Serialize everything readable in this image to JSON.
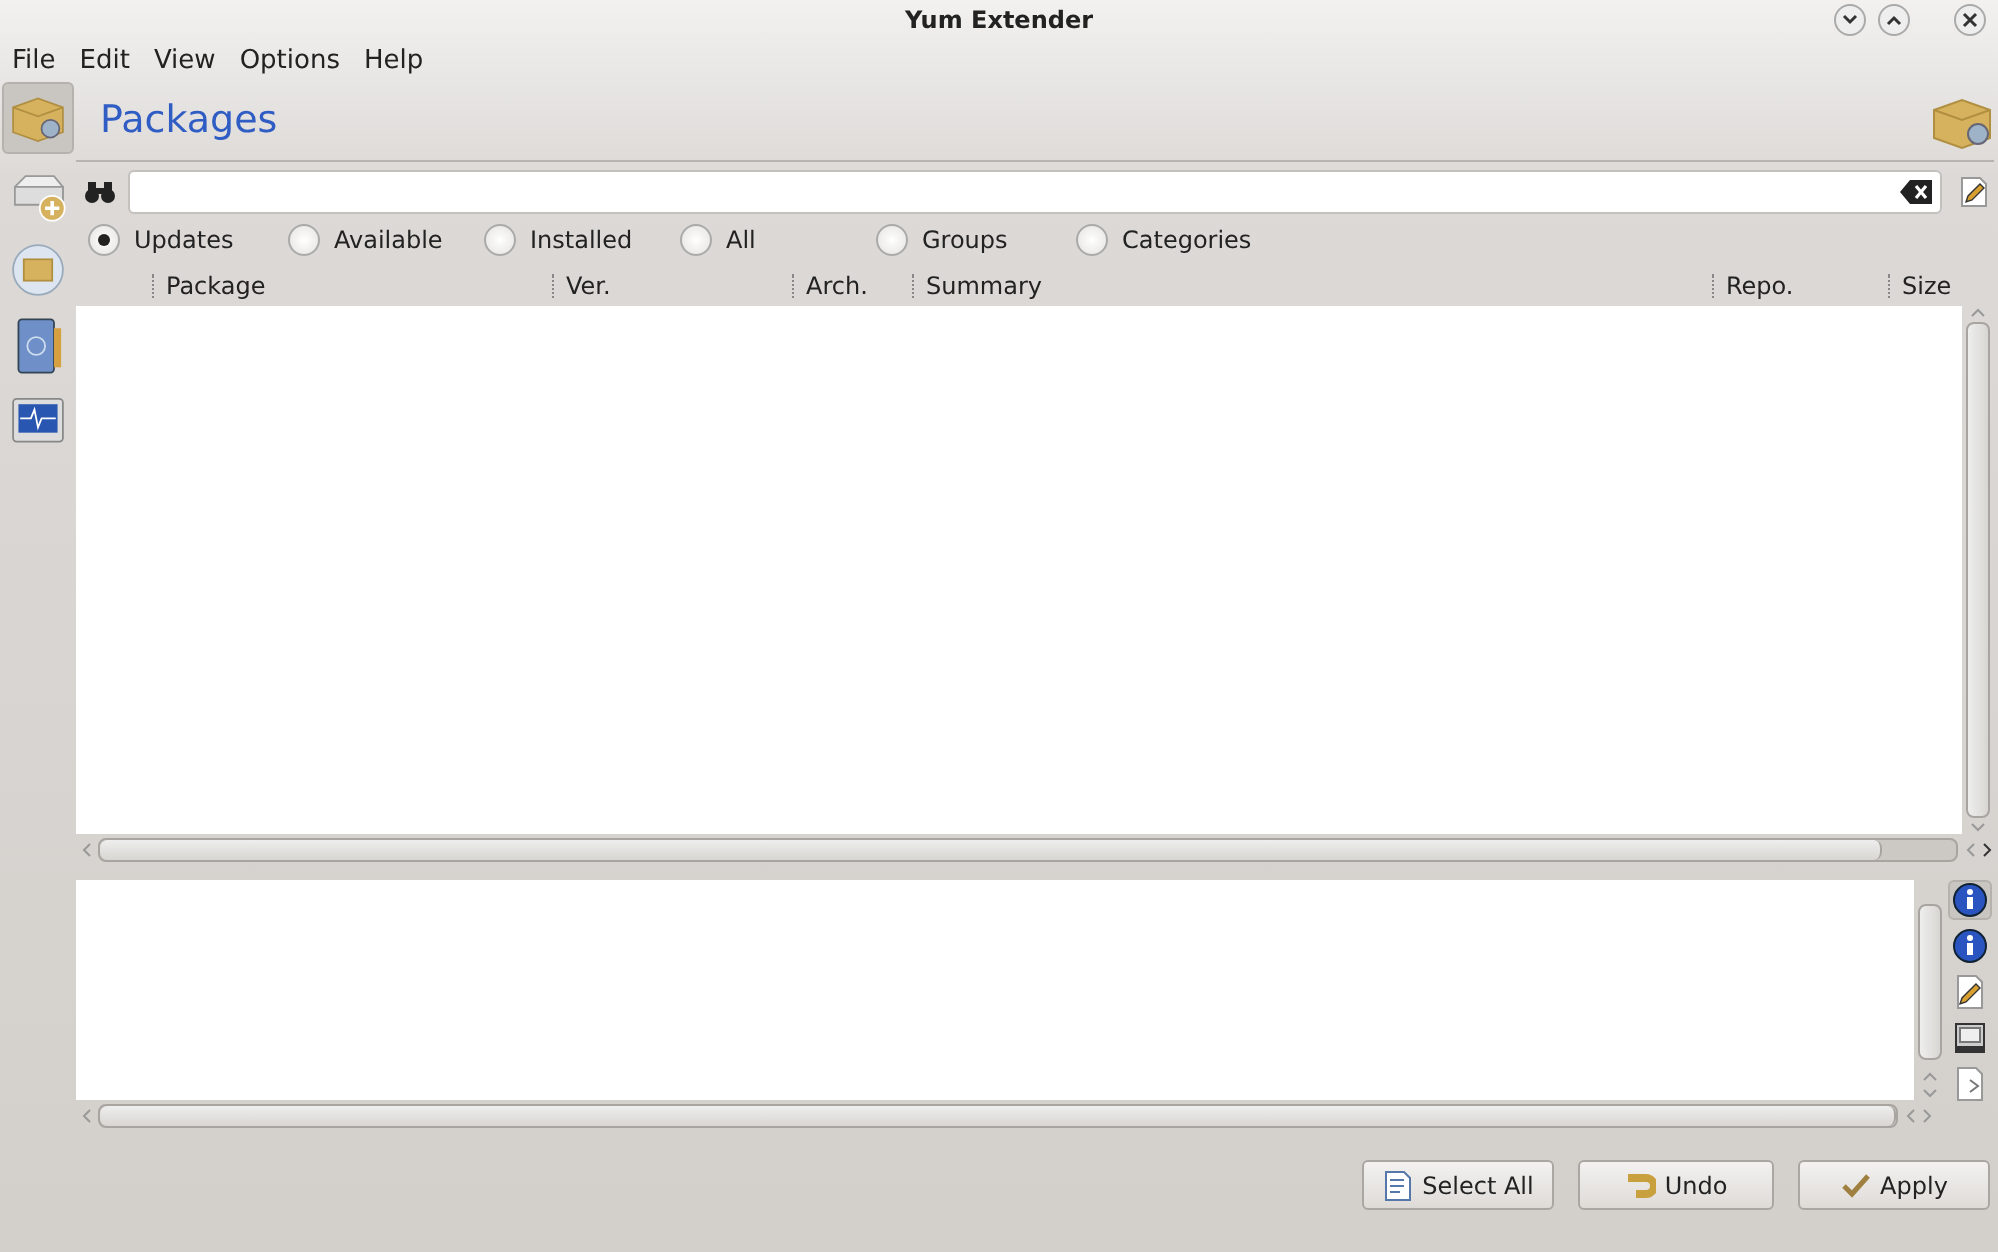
{
  "window": {
    "title": "Yum Extender"
  },
  "menu": [
    {
      "label": "File"
    },
    {
      "label": "Edit"
    },
    {
      "label": "View"
    },
    {
      "label": "Options"
    },
    {
      "label": "Help"
    }
  ],
  "sidebar": {
    "items": [
      {
        "kind": "packages",
        "selected": true
      },
      {
        "kind": "repos",
        "selected": false
      },
      {
        "kind": "queue",
        "selected": false
      },
      {
        "kind": "history",
        "selected": false
      },
      {
        "kind": "output",
        "selected": false
      }
    ]
  },
  "page_title": "Packages",
  "filters": [
    {
      "label": "Updates",
      "selected": true
    },
    {
      "label": "Available",
      "selected": false
    },
    {
      "label": "Installed",
      "selected": false
    },
    {
      "label": "All",
      "selected": false
    },
    {
      "label": "Groups",
      "selected": false
    },
    {
      "label": "Categories",
      "selected": false
    }
  ],
  "table": {
    "columns": [
      "Package",
      "Ver.",
      "Arch.",
      "Summary",
      "Repo.",
      "Size"
    ]
  },
  "info_tabs": [
    {
      "kind": "info",
      "selected": true
    },
    {
      "kind": "info",
      "selected": false
    },
    {
      "kind": "changelog",
      "selected": false
    },
    {
      "kind": "files",
      "selected": false
    },
    {
      "kind": "deps",
      "selected": false
    }
  ],
  "buttons": [
    {
      "kind": "select",
      "label": "Select All"
    },
    {
      "kind": "undo",
      "label": "Undo"
    },
    {
      "kind": "apply",
      "label": "Apply"
    }
  ]
}
